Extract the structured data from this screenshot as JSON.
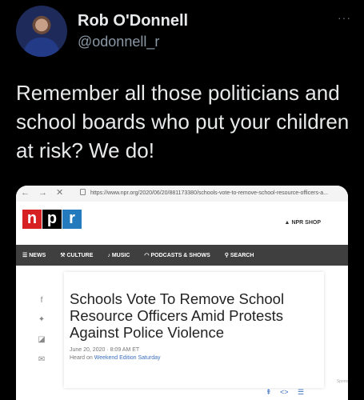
{
  "user": {
    "name": "Rob O'Donnell",
    "handle": "@odonnell_r",
    "more": "···"
  },
  "tweet": {
    "text": "Remember all those politicians and school boards who put your children at risk? We do!"
  },
  "browser": {
    "back": "←",
    "forward": "→",
    "close": "✕",
    "url": "https://www.npr.org/2020/06/20/881173380/schools-vote-to-remove-school-resource-officers-a..."
  },
  "npr": {
    "logo": [
      "n",
      "p",
      "r"
    ],
    "logo_colors": [
      "#d62021",
      "#000000",
      "#237bbd"
    ],
    "shop": "NPR SHOP",
    "menu": [
      {
        "icon": "☰",
        "label": "NEWS"
      },
      {
        "icon": "⚒",
        "label": "CULTURE"
      },
      {
        "icon": "♪",
        "label": "MUSIC"
      },
      {
        "icon": "◠",
        "label": "PODCASTS & SHOWS"
      },
      {
        "icon": "⚲",
        "label": "SEARCH"
      }
    ],
    "article": {
      "headline": "Schools Vote To Remove School Resource Officers Amid Protests Against Police Violence",
      "date": "June 20, 2020 · 8:09 AM ET",
      "heard_prefix": "Heard on",
      "heard_show": "Weekend Edition Saturday"
    },
    "sponsor": "Spons",
    "bottom_icons": [
      "⇞",
      "<>",
      "☰"
    ]
  }
}
